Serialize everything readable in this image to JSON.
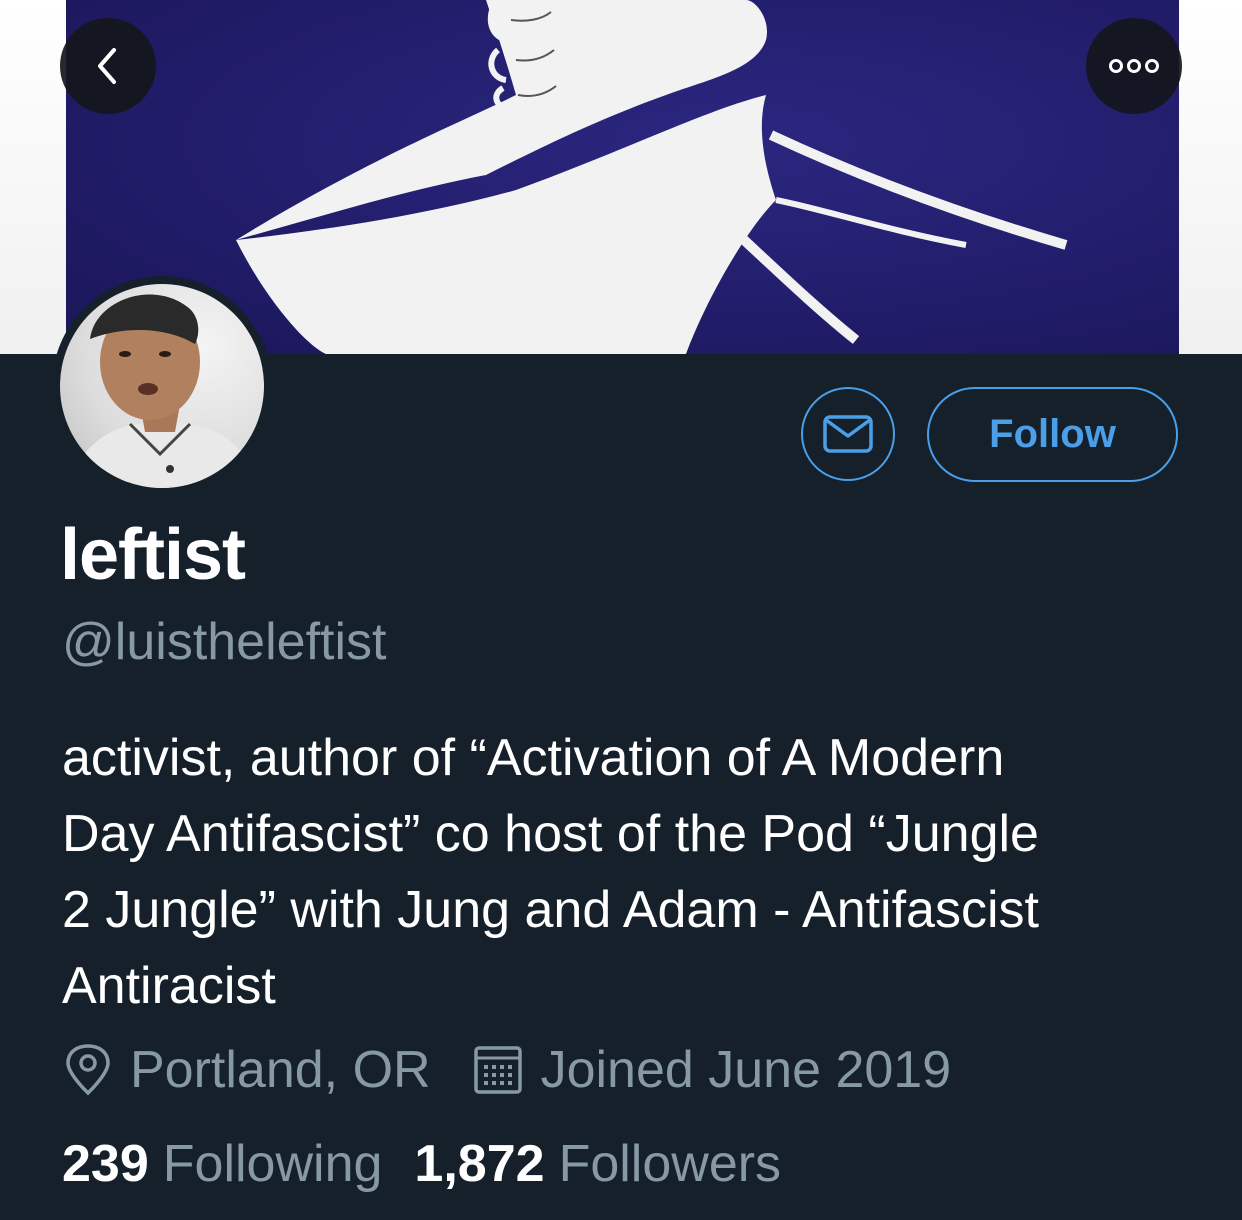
{
  "header": {
    "back_icon": "chevron-left-icon",
    "more_icon": "more-horizontal-icon"
  },
  "profile": {
    "display_name": "leftist",
    "handle": "@luistheleftist",
    "bio": "activist, author of “Activation of A Modern\nDay Antifascist” co host of the Pod “Jungle\n2 Jungle” with Jung and Adam - Antifascist\nAntiracist",
    "location": "Portland, OR",
    "joined": "Joined June 2019"
  },
  "actions": {
    "message_icon": "envelope-icon",
    "follow_label": "Follow"
  },
  "stats": {
    "following_count": "239",
    "following_label": "Following",
    "followers_count": "1,872",
    "followers_label": "Followers"
  },
  "colors": {
    "background": "#15202b",
    "accent": "#4a9fe8",
    "secondary_text": "#8899a6",
    "primary_text": "#ffffff",
    "banner_blue": "#221d6b"
  }
}
